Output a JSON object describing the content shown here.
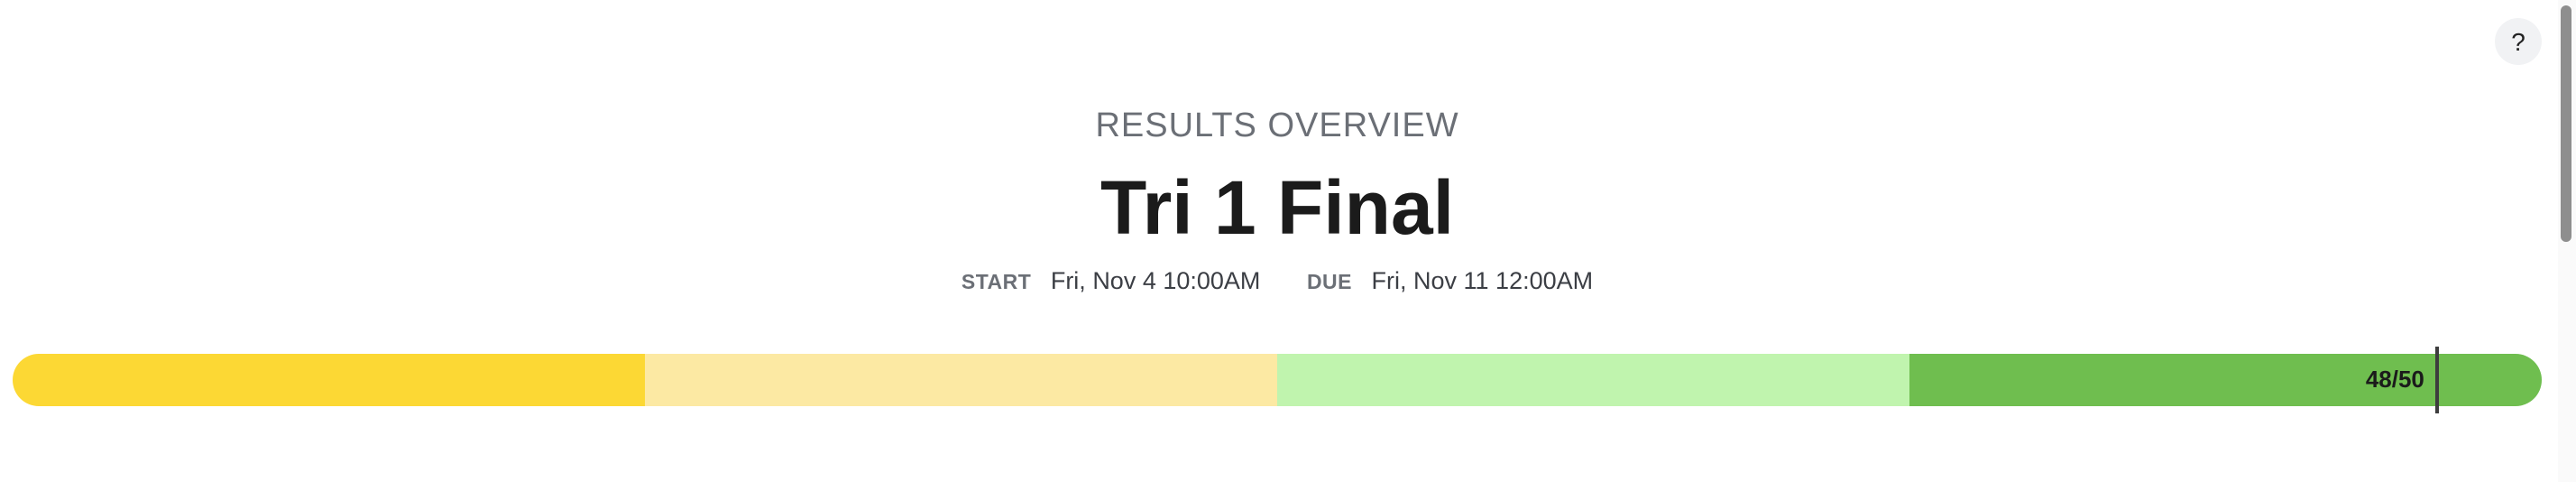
{
  "help": {
    "label": "?"
  },
  "header": {
    "eyebrow": "RESULTS OVERVIEW",
    "title": "Tri 1 Final"
  },
  "dates": {
    "start_label": "START",
    "start_value": "Fri, Nov 4 10:00AM",
    "due_label": "DUE",
    "due_value": "Fri, Nov 11 12:00AM"
  },
  "score": {
    "text": "48/50",
    "earned": 48,
    "total": 50
  },
  "progress": {
    "segment_colors": [
      "#FCD834",
      "#FCE9A3",
      "#C0F4AE",
      "#6FBE4F"
    ]
  }
}
